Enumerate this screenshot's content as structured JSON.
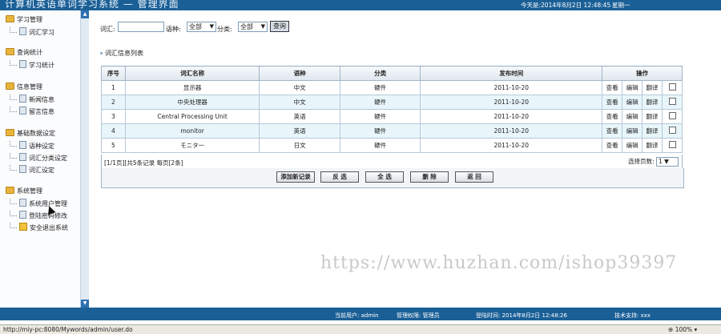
{
  "header": {
    "title": "计算机英语单词学习系统 — 管理界面",
    "date": "今天是:2014年8月2日  12:48:45",
    "week": "星期一"
  },
  "sidebar": {
    "groups": [
      {
        "label": "学习管理",
        "items": [
          "词汇学习"
        ]
      },
      {
        "label": "查询统计",
        "items": [
          "学习统计"
        ]
      },
      {
        "label": "信息管理",
        "items": [
          "新闻信息",
          "留言信息"
        ]
      },
      {
        "label": "基础数据设定",
        "items": [
          "语种设定",
          "词汇分类设定",
          "词汇设定"
        ]
      },
      {
        "label": "系统管理",
        "items": [
          "系统用户管理",
          "登陆密码修改",
          "安全退出系统"
        ]
      }
    ]
  },
  "search": {
    "word_label": "词汇:",
    "word_value": "",
    "lang_label": "语种:",
    "lang_value": "全部",
    "cat_label": "分类:",
    "cat_value": "全部",
    "query_button": "查询"
  },
  "list_title": "词汇信息列表",
  "table": {
    "headers": [
      "序号",
      "词汇名称",
      "语种",
      "分类",
      "发布时间",
      "操作"
    ],
    "rows": [
      {
        "no": "1",
        "name": "显示器",
        "lang": "中文",
        "cat": "硬件",
        "time": "2011-10-20"
      },
      {
        "no": "2",
        "name": "中央处理器",
        "lang": "中文",
        "cat": "硬件",
        "time": "2011-10-20"
      },
      {
        "no": "3",
        "name": "Central Processing Unit",
        "lang": "英语",
        "cat": "硬件",
        "time": "2011-10-20"
      },
      {
        "no": "4",
        "name": "monitor",
        "lang": "英语",
        "cat": "硬件",
        "time": "2011-10-20"
      },
      {
        "no": "5",
        "name": "モニタ一",
        "lang": "日文",
        "cat": "硬件",
        "time": "2011-10-20"
      }
    ],
    "ops": {
      "view": "查看",
      "edit": "编辑",
      "translate": "翻译"
    }
  },
  "pager": {
    "info": "[1/1页][共5条记录 每页[2条]",
    "select_label": "选择页数:",
    "select_value": "1"
  },
  "actions": {
    "add": "添加新记录",
    "invert": "反 选",
    "all": "全 选",
    "delete": "删 除",
    "back": "返 回"
  },
  "watermark": "https://www.huzhan.com/ishop39397",
  "footer": {
    "user": "当前用户: admin",
    "role": "管理权限: 管理员",
    "login_time": "登陆时间: 2014年8月2日  12:48:26",
    "support": "技术支持: xxx"
  },
  "statusbar": {
    "url": "http://miy-pc:8080/Mywords/admin/user.do",
    "zoom": "100%"
  },
  "colors": {
    "header": "#1a5f96",
    "row_alt": "#e8f6fb",
    "folder": "#e8b43c"
  }
}
